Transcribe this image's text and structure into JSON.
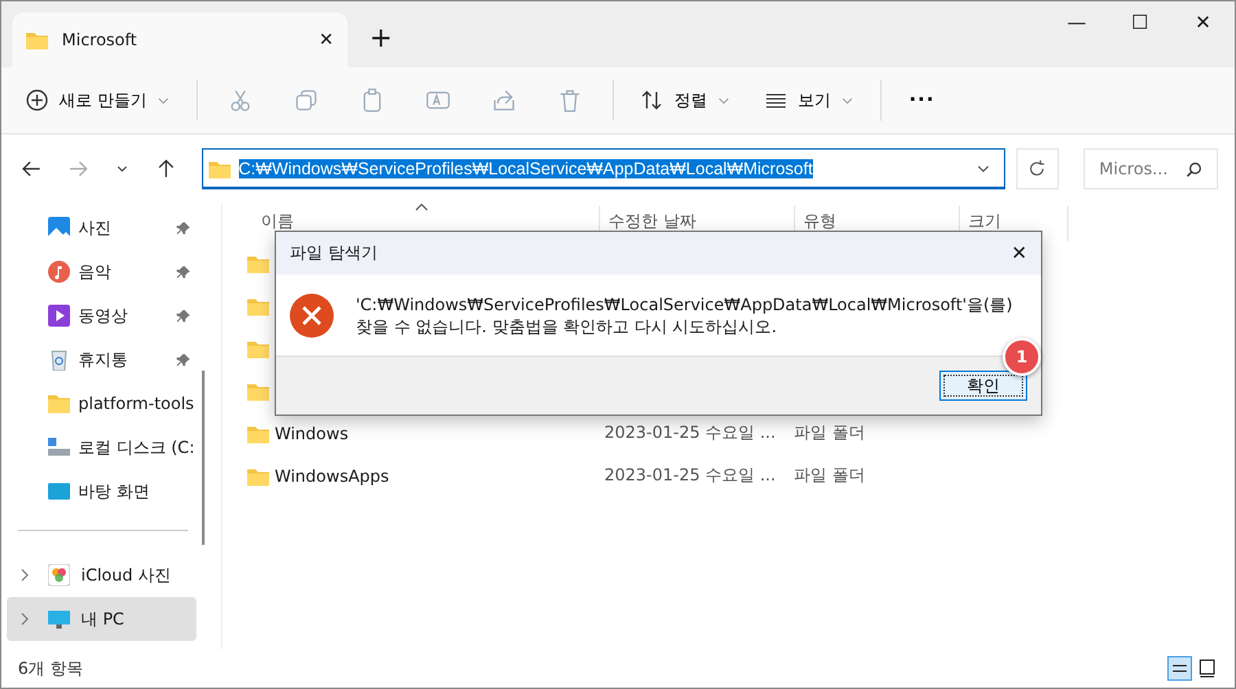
{
  "tab": {
    "title": "Microsoft",
    "close": "✕",
    "new": "+"
  },
  "window_controls": {
    "minimize": "—",
    "maximize": "☐",
    "close": "✕"
  },
  "toolbar": {
    "new": "새로 만들기",
    "sort": "정렬",
    "view": "보기",
    "more": "···"
  },
  "address": {
    "path": "C:₩Windows₩ServiceProfiles₩LocalService₩AppData₩Local₩Microsoft",
    "selected": true
  },
  "search": {
    "placeholder": "Micros..."
  },
  "sidebar": {
    "items": [
      {
        "label": "사진",
        "pinned": true
      },
      {
        "label": "음악",
        "pinned": true
      },
      {
        "label": "동영상",
        "pinned": true
      },
      {
        "label": "휴지통",
        "pinned": true
      },
      {
        "label": "platform-tools",
        "pinned": false
      },
      {
        "label": "로컬 디스크 (C:",
        "pinned": false
      },
      {
        "label": "바탕 화면",
        "pinned": false
      }
    ],
    "tree": [
      {
        "label": "iCloud 사진",
        "selected": false
      },
      {
        "label": "내 PC",
        "selected": true
      }
    ]
  },
  "table": {
    "columns": [
      "이름",
      "수정한 날짜",
      "유형",
      "크기"
    ],
    "rows": [
      {
        "kind": "covered"
      },
      {
        "kind": "covered"
      },
      {
        "kind": "covered"
      },
      {
        "kind": "covered"
      },
      {
        "kind": "folder",
        "name": "Windows",
        "date": "2023-01-25 수요일 ...",
        "type": "파일 폴더"
      },
      {
        "kind": "folder",
        "name": "WindowsApps",
        "date": "2023-01-25 수요일 ...",
        "type": "파일 폴더"
      }
    ]
  },
  "status_bar": {
    "count": "6개 항목"
  },
  "dialog": {
    "title": "파일 탐색기",
    "close": "✕",
    "message": "'C:₩Windows₩ServiceProfiles₩LocalService₩AppData₩Local₩Microsoft'을(를) 찾을 수 없습니다. 맞춤법을 확인하고 다시 시도하십시오.",
    "ok": "확인",
    "callout": "1"
  }
}
